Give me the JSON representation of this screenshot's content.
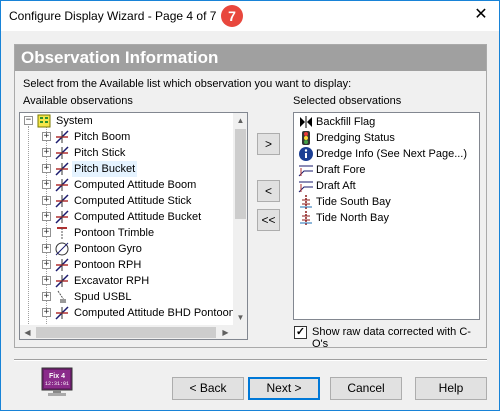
{
  "window": {
    "title": "Configure Display Wizard - Page 4 of 7",
    "step_badge": "7",
    "close_glyph": "✕"
  },
  "panel": {
    "header": "Observation Information",
    "instruction": "Select from the Available list which observation you want to display:",
    "available_label": "Available observations",
    "selected_label": "Selected observations"
  },
  "available": {
    "root": {
      "label": "System",
      "icon": "system-icon",
      "expander": "−"
    },
    "items": [
      {
        "label": "Pitch Boom",
        "icon": "pitch-icon",
        "expander": "+"
      },
      {
        "label": "Pitch Stick",
        "icon": "pitch-icon",
        "expander": "+"
      },
      {
        "label": "Pitch Bucket",
        "icon": "pitch-icon",
        "expander": "+",
        "selected": true
      },
      {
        "label": "Computed Attitude Boom",
        "icon": "pitch-icon",
        "expander": "+"
      },
      {
        "label": "Computed Attitude Stick",
        "icon": "pitch-icon",
        "expander": "+"
      },
      {
        "label": "Computed Attitude Bucket",
        "icon": "pitch-icon",
        "expander": "+"
      },
      {
        "label": "Pontoon Trimble",
        "icon": "pontoon-icon",
        "expander": "+"
      },
      {
        "label": "Pontoon Gyro",
        "icon": "gyro-icon",
        "expander": "+"
      },
      {
        "label": "Pontoon RPH",
        "icon": "pitch-icon",
        "expander": "+"
      },
      {
        "label": "Excavator RPH",
        "icon": "pitch-icon",
        "expander": "+"
      },
      {
        "label": "Spud USBL",
        "icon": "usbl-icon",
        "expander": "+"
      },
      {
        "label": "Computed Attitude BHD Pontoon",
        "icon": "pitch-icon",
        "expander": "+"
      }
    ]
  },
  "selected": {
    "items": [
      {
        "label": "Backfill Flag",
        "icon": "flag-icon"
      },
      {
        "label": "Dredging Status",
        "icon": "traffic-light-icon"
      },
      {
        "label": "Dredge Info (See Next Page...)",
        "icon": "info-icon"
      },
      {
        "label": "Draft Fore",
        "icon": "draft-icon"
      },
      {
        "label": "Draft Aft",
        "icon": "draft-icon"
      },
      {
        "label": "Tide South Bay",
        "icon": "tide-icon"
      },
      {
        "label": "Tide North Bay",
        "icon": "tide-icon"
      }
    ]
  },
  "transfer": {
    "add": ">",
    "remove": "<",
    "remove_all": "<<"
  },
  "options": {
    "raw_data_label": "Show raw data corrected with C-O's",
    "raw_data_checked": "✓"
  },
  "logo": {
    "text": "Fix 4",
    "subtext": "12:31:01"
  },
  "buttons": {
    "back": "< Back",
    "next": "Next >",
    "cancel": "Cancel",
    "help": "Help"
  },
  "scroll": {
    "up": "▲",
    "down": "▼",
    "left": "◀",
    "right": "▶"
  },
  "colors": {
    "header_bg": "#a0a0a0",
    "badge": "#e8473d",
    "accent": "#0078d7",
    "selection": "#e5f3ff"
  }
}
